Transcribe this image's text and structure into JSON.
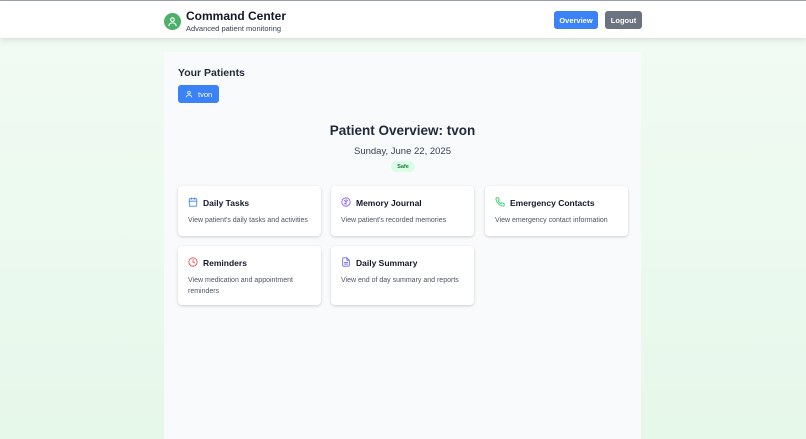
{
  "header": {
    "title": "Command Center",
    "subtitle": "Advanced patient monitoring",
    "overview_label": "Overview",
    "logout_label": "Logout"
  },
  "patients": {
    "section_title": "Your Patients",
    "items": [
      {
        "name": "tvon",
        "icon": "user-icon"
      }
    ]
  },
  "overview": {
    "title": "Patient Overview: tvon",
    "date": "Sunday, June 22, 2025",
    "status": "Safe"
  },
  "cards": [
    {
      "title": "Daily Tasks",
      "description": "View patient's daily tasks and activities",
      "icon": "calendar-icon",
      "color": "#3b82f6"
    },
    {
      "title": "Memory Journal",
      "description": "View patient's recorded memories",
      "icon": "brain-icon",
      "color": "#8b5cf6"
    },
    {
      "title": "Emergency Contacts",
      "description": "View emergency contact information",
      "icon": "phone-icon",
      "color": "#22c55e"
    },
    {
      "title": "Reminders",
      "description": "View medication and appointment reminders",
      "icon": "clock-icon",
      "color": "#ef4444"
    },
    {
      "title": "Daily Summary",
      "description": "View end of day summary and reports",
      "icon": "document-icon",
      "color": "#6366f1"
    }
  ],
  "colors": {
    "primary": "#3b82f6",
    "secondary": "#6b7280",
    "brand": "#4caf6a",
    "safe_bg": "#dcfce7",
    "safe_text": "#15803d"
  }
}
